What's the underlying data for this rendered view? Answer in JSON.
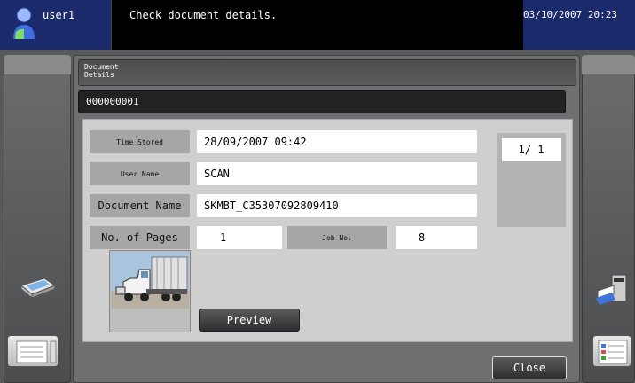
{
  "header": {
    "user_name": "user1",
    "message": "Check document details.",
    "datetime": "03/10/2007 20:23"
  },
  "dialog": {
    "title": "Document Details",
    "document_id": "000000001",
    "fields": {
      "time_stored_label": "Time Stored",
      "time_stored_value": "28/09/2007 09:42",
      "user_name_label": "User Name",
      "user_name_value": "SCAN",
      "document_name_label": "Document Name",
      "document_name_value": "SKMBT_C35307092809410",
      "pages_label": "No. of Pages",
      "pages_value": "1",
      "job_label": "Job No.",
      "job_value": "8"
    },
    "page_indicator": "1/  1",
    "preview_button": "Preview",
    "close_button": "Close"
  },
  "icons": {
    "user": "user-icon",
    "scanner": "scanner-icon",
    "printer": "printer-icon",
    "job_list": "job-list-icon",
    "job_list_right": "job-list-right-icon"
  },
  "colors": {
    "header_blue": "#1a2a6b",
    "panel_gray": "#6e6f71",
    "content_gray": "#cfcfcf",
    "label_gray": "#a6a6a6"
  }
}
